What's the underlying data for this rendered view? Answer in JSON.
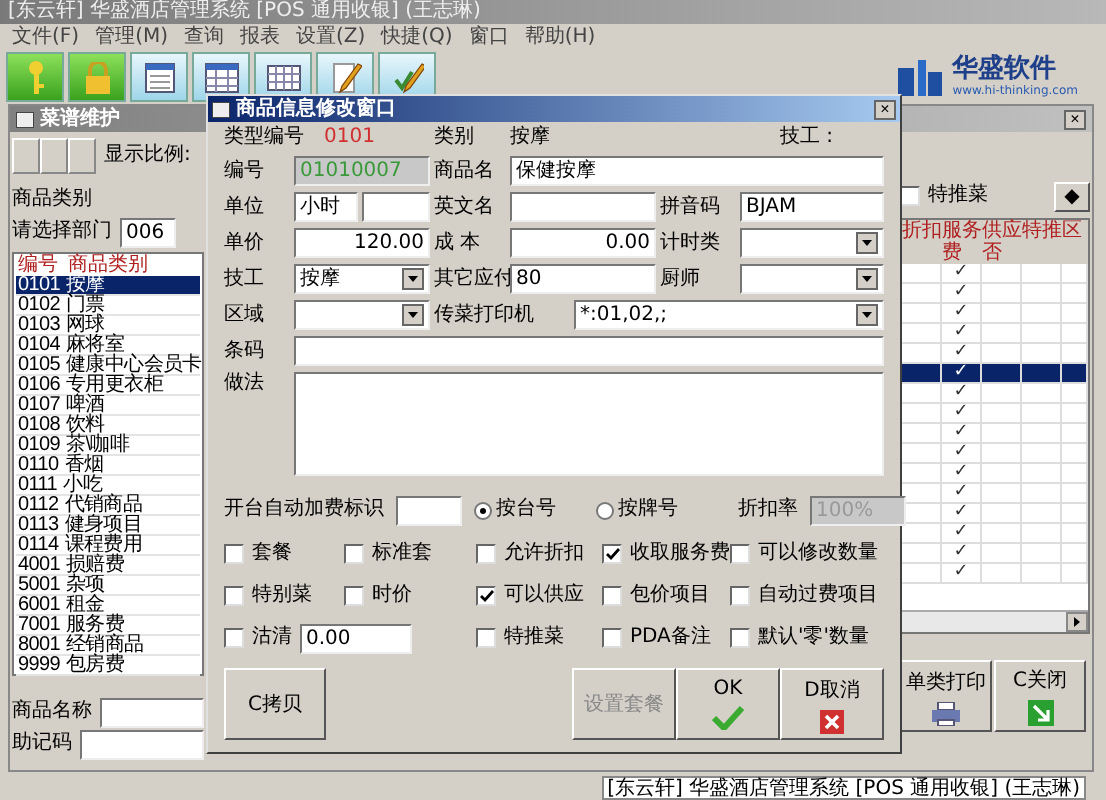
{
  "app_title": "[东云轩] 华盛酒店管理系统 [POS 通用收银] (王志琳)",
  "menu": [
    "文件(F)",
    "管理(M)",
    "查询",
    "报表",
    "设置(Z)",
    "快捷(Q)",
    "窗口",
    "帮助(H)"
  ],
  "toolbar": [
    {
      "kind": "key"
    },
    {
      "kind": "lock"
    },
    {
      "kind": "calendar"
    },
    {
      "kind": "grid"
    },
    {
      "kind": "table"
    },
    {
      "kind": "pencil"
    },
    {
      "kind": "pencil-check"
    }
  ],
  "logo": {
    "name": "华盛软件",
    "url": "www.hi-thinking.com"
  },
  "menu_window": {
    "title": "菜谱维护",
    "scale_label": "显示比例:",
    "category_heading": "商品类别",
    "dept_label": "请选择部门",
    "dept_value": "006",
    "list_columns": [
      "编号",
      "商品类别"
    ],
    "categories": [
      {
        "code": "0101",
        "name": "按摩",
        "selected": true
      },
      {
        "code": "0102",
        "name": "门票",
        "selected": false
      },
      {
        "code": "0103",
        "name": "网球",
        "selected": false
      },
      {
        "code": "0104",
        "name": "麻将室",
        "selected": false
      },
      {
        "code": "0105",
        "name": "健康中心会员卡",
        "selected": false
      },
      {
        "code": "0106",
        "name": "专用更衣柜",
        "selected": false
      },
      {
        "code": "0107",
        "name": "啤酒",
        "selected": false
      },
      {
        "code": "0108",
        "name": "饮料",
        "selected": false
      },
      {
        "code": "0109",
        "name": "茶\\咖啡",
        "selected": false
      },
      {
        "code": "0110",
        "name": "香烟",
        "selected": false
      },
      {
        "code": "0111",
        "name": "小吃",
        "selected": false
      },
      {
        "code": "0112",
        "name": "代销商品",
        "selected": false
      },
      {
        "code": "0113",
        "name": "健身项目",
        "selected": false
      },
      {
        "code": "0114",
        "name": "课程费用",
        "selected": false
      },
      {
        "code": "4001",
        "name": "损赔费",
        "selected": false
      },
      {
        "code": "5001",
        "name": "杂项",
        "selected": false
      },
      {
        "code": "6001",
        "name": "租金",
        "selected": false
      },
      {
        "code": "7001",
        "name": "服务费",
        "selected": false
      },
      {
        "code": "8001",
        "name": "经销商品",
        "selected": false
      },
      {
        "code": "9999",
        "name": "包房费",
        "selected": false
      }
    ],
    "special": {
      "label": "特推菜",
      "checked": false
    },
    "diamond_button": "◆",
    "grid_columns": [
      "折扣",
      "服务费",
      "供应否",
      "特推",
      "区"
    ],
    "grid_rows": [
      {
        "service": "✓",
        "selected": false
      },
      {
        "service": "✓",
        "selected": false
      },
      {
        "service": "✓",
        "selected": false
      },
      {
        "service": "✓",
        "selected": false
      },
      {
        "service": "✓",
        "selected": false
      },
      {
        "service": "✓",
        "selected": true
      },
      {
        "service": "✓",
        "selected": false
      },
      {
        "service": "✓",
        "selected": false
      },
      {
        "service": "✓",
        "selected": false
      },
      {
        "service": "✓",
        "selected": false
      },
      {
        "service": "✓",
        "selected": false
      },
      {
        "service": "✓",
        "selected": false
      },
      {
        "service": "✓",
        "selected": false
      },
      {
        "service": "✓",
        "selected": false
      },
      {
        "service": "✓",
        "selected": false
      },
      {
        "service": "✓",
        "selected": false
      }
    ],
    "name_label": "商品名称",
    "code_label": "助记码",
    "print_button": "单类打印",
    "close_button": "C关闭"
  },
  "dialog": {
    "title": "商品信息修改窗口",
    "close": "×",
    "type_code_label": "类型编号",
    "type_code": "0101",
    "category_label": "类别",
    "category": "按摩",
    "tech_label": "技工 :",
    "code_label": "编号",
    "code": "01010007",
    "name_label": "商品名",
    "name": "保健按摩",
    "unit_label": "单位",
    "unit": "小时",
    "english_label": "英文名",
    "pinyin_label": "拼音码",
    "pinyin": "BJAM",
    "price_label": "单价",
    "price": "120.00",
    "cost_label": "成 本",
    "cost": "0.00",
    "timing_label": "计时类",
    "tech2_label": "技工",
    "tech2": "按摩",
    "other_label": "其它应付",
    "other": "80",
    "chef_label": "厨师",
    "area_label": "区域",
    "printer_label": "传菜打印机",
    "printer": "*:01,02,;",
    "barcode_label": "条码",
    "method_label": "做法",
    "auto_fee_label": "开台自动加费标识",
    "radios": [
      {
        "label": "按台号",
        "selected": true
      },
      {
        "label": "按牌号",
        "selected": false
      }
    ],
    "discount_label": "折扣率",
    "discount": "100%",
    "checkboxes": [
      [
        {
          "label": "套餐",
          "checked": false
        },
        {
          "label": "标准套",
          "checked": false
        },
        {
          "label": "允许折扣",
          "checked": false
        },
        {
          "label": "收取服务费",
          "checked": true
        },
        {
          "label": "可以修改数量",
          "checked": false
        }
      ],
      [
        {
          "label": "特别菜",
          "checked": false
        },
        {
          "label": "时价",
          "checked": false
        },
        {
          "label": "可以供应",
          "checked": true
        },
        {
          "label": "包价项目",
          "checked": false
        },
        {
          "label": "自动过费项目",
          "checked": false
        }
      ],
      [
        {
          "label": "沽清",
          "checked": false,
          "value": "0.00"
        },
        {
          "label": "特推菜",
          "checked": false
        },
        {
          "label": "PDA备注",
          "checked": false
        },
        {
          "label": "默认'零'数量",
          "checked": false
        }
      ]
    ],
    "copy_button": "C拷贝",
    "set_button": "设置套餐",
    "ok_button": "OK",
    "cancel_button": "D取消"
  },
  "status_bar": "[东云轩] 华盛酒店管理系统 [POS 通用收银] (王志琳)"
}
